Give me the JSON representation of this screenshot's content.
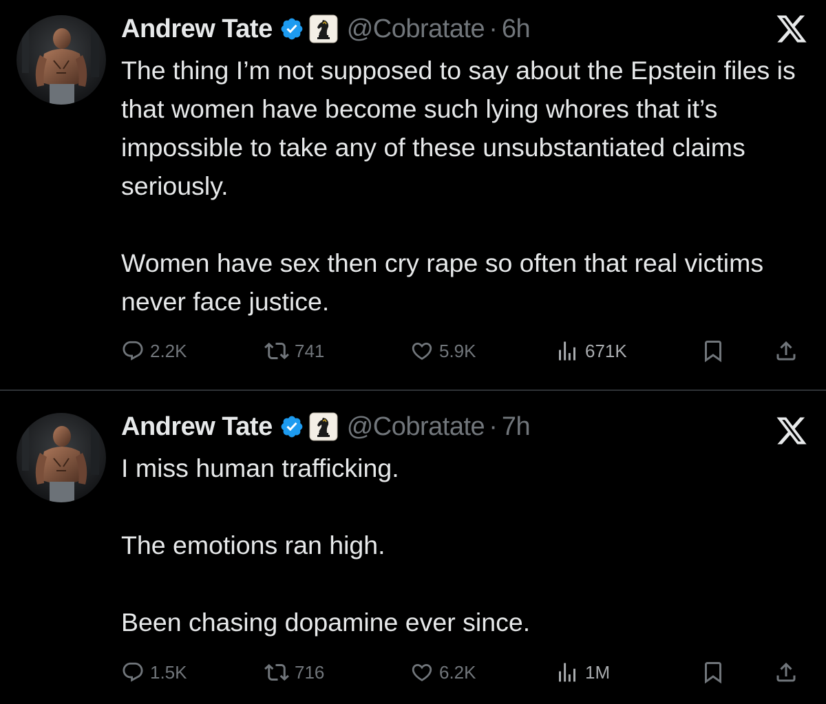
{
  "tweets": [
    {
      "author": {
        "name": "Andrew Tate",
        "handle": "@Cobratate",
        "separator": "·",
        "time": "6h",
        "verified_icon": "verified-badge-icon",
        "affiliate_icon": "chess-knight-icon"
      },
      "paragraphs": [
        "The thing I’m not supposed to say about the Epstein files is that women have become such lying whores that it’s impossible to take any of these unsubstantiated claims seriously.",
        "Women have sex then cry rape so often that real victims never face justice."
      ],
      "stats": {
        "replies": "2.2K",
        "reposts": "741",
        "likes": "5.9K",
        "views": "671K"
      }
    },
    {
      "author": {
        "name": "Andrew Tate",
        "handle": "@Cobratate",
        "separator": "·",
        "time": "7h",
        "verified_icon": "verified-badge-icon",
        "affiliate_icon": "chess-knight-icon"
      },
      "paragraphs": [
        "I miss human trafficking.",
        "The emotions ran high.",
        "Been chasing dopamine ever since."
      ],
      "stats": {
        "replies": "1.5K",
        "reposts": "716",
        "likes": "6.2K",
        "views": "1M"
      }
    }
  ],
  "colors": {
    "background": "#000000",
    "text": "#e7e9ea",
    "secondary": "#71767b",
    "verified": "#1d9bf0",
    "divider": "#2f3336"
  },
  "icons": {
    "brand": "x-logo-icon",
    "reply": "reply-bubble-icon",
    "repost": "repost-icon",
    "like": "heart-icon",
    "views": "views-bar-chart-icon",
    "bookmark": "bookmark-icon",
    "share": "share-icon"
  }
}
